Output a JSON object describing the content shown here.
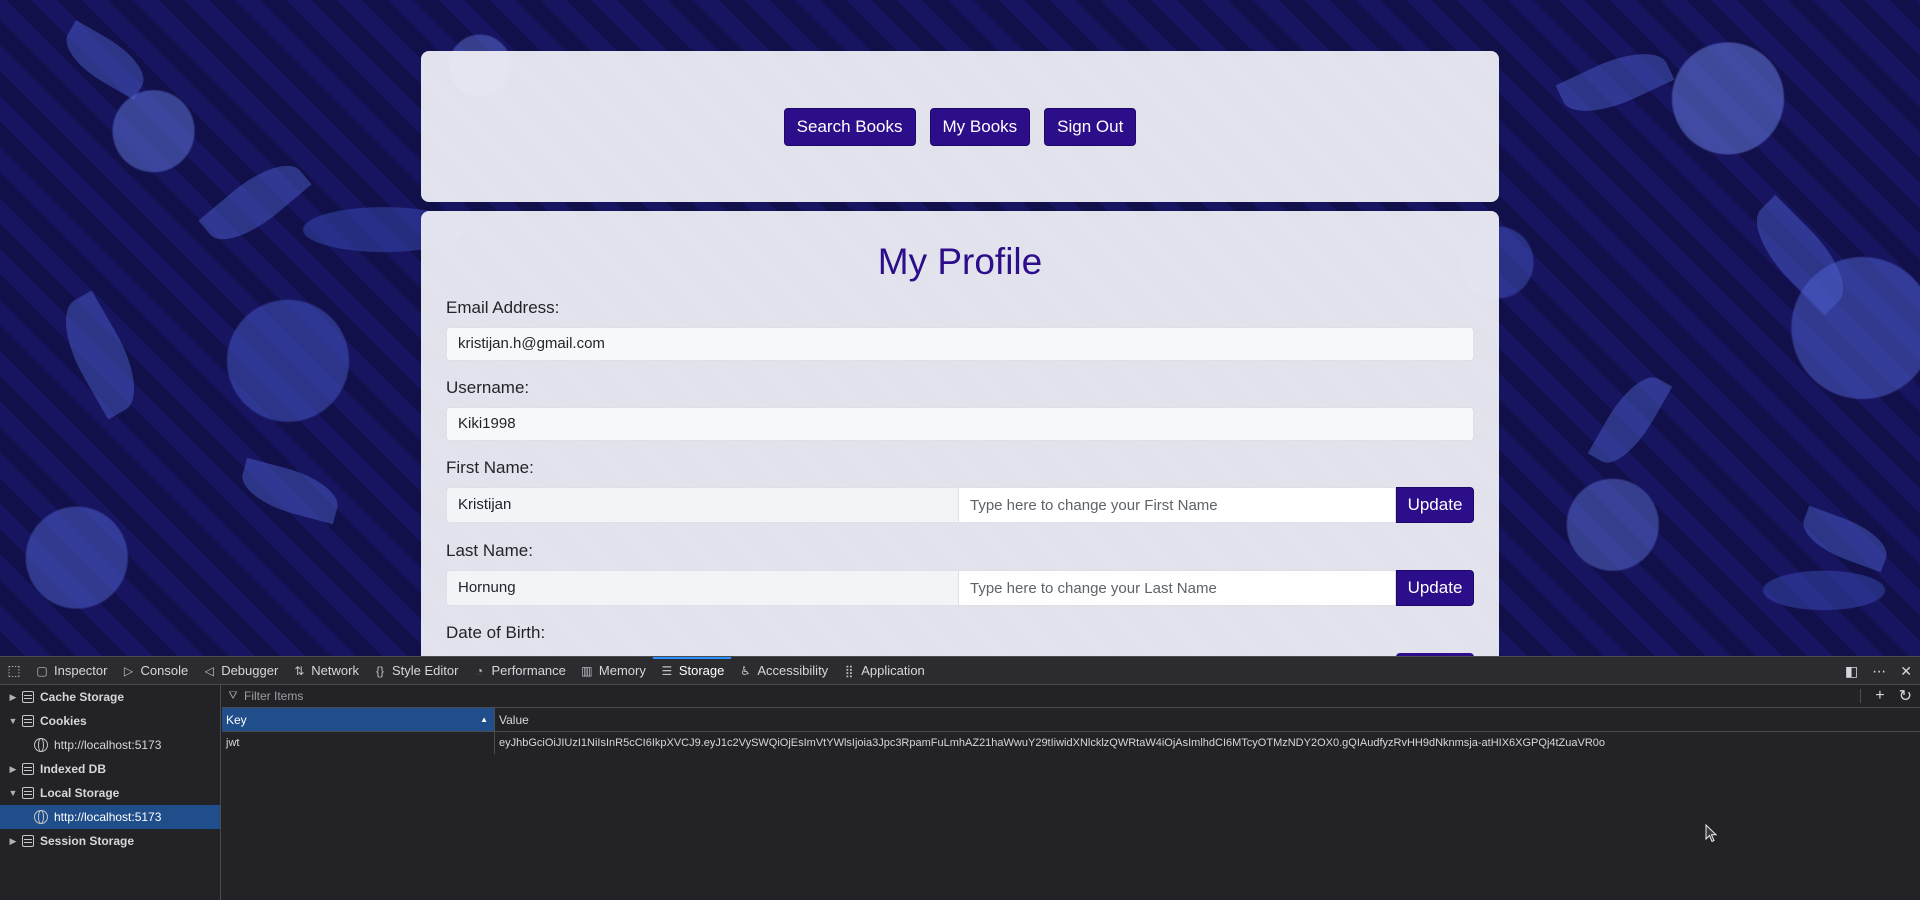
{
  "nav": {
    "search_books": "Search Books",
    "my_books": "My Books",
    "sign_out": "Sign Out"
  },
  "profile": {
    "title": "My Profile",
    "email_label": "Email Address:",
    "email_value": "kristijan.h@gmail.com",
    "username_label": "Username:",
    "username_value": "Kiki1998",
    "first_name_label": "First Name:",
    "first_name_value": "Kristijan",
    "first_name_placeholder": "Type here to change your First Name",
    "last_name_label": "Last Name:",
    "last_name_value": "Hornung",
    "last_name_placeholder": "Type here to change your Last Name",
    "dob_label": "Date of Birth:",
    "update_label": "Update"
  },
  "devtools": {
    "tabs": [
      {
        "label": "Inspector",
        "icon": "inspector-icon"
      },
      {
        "label": "Console",
        "icon": "console-icon"
      },
      {
        "label": "Debugger",
        "icon": "debugger-icon"
      },
      {
        "label": "Network",
        "icon": "network-icon"
      },
      {
        "label": "Style Editor",
        "icon": "style-editor-icon"
      },
      {
        "label": "Performance",
        "icon": "performance-icon"
      },
      {
        "label": "Memory",
        "icon": "memory-icon"
      },
      {
        "label": "Storage",
        "icon": "storage-icon"
      },
      {
        "label": "Accessibility",
        "icon": "accessibility-icon"
      },
      {
        "label": "Application",
        "icon": "application-icon"
      }
    ],
    "selected_tab": "Storage",
    "sidebar": {
      "cache_storage": "Cache Storage",
      "cookies": "Cookies",
      "cookies_child": "http://localhost:5173",
      "indexed_db": "Indexed DB",
      "local_storage": "Local Storage",
      "local_storage_child": "http://localhost:5173",
      "session_storage": "Session Storage"
    },
    "filter_placeholder": "Filter Items",
    "table": {
      "key_header": "Key",
      "value_header": "Value",
      "rows": [
        {
          "key": "jwt",
          "value": "eyJhbGciOiJIUzI1NiIsInR5cCI6IkpXVCJ9.eyJ1c2VySWQiOjEsImVtYWlsIjoia3Jpc3RpamFuLmhAZ21haWwuY29tIiwidXNlcklzQWRtaW4iOjAsImlhdCI6MTcyOTMzNDY2OX0.gQIAudfyzRvHH9dNknmsja-atHIX6XGPQj4tZuaVR0o"
        }
      ]
    },
    "accent_color": "#2a90ff",
    "selection_color": "#204e8a"
  },
  "colors": {
    "brand_purple": "#2c0e8a"
  }
}
